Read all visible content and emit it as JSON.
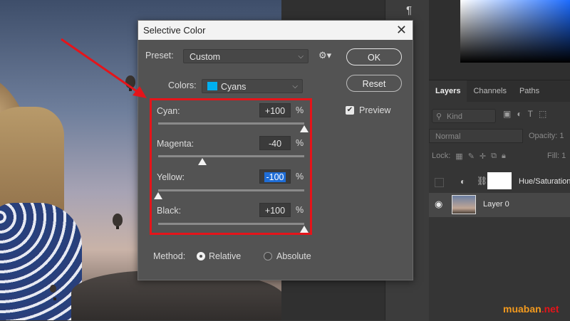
{
  "dialog": {
    "title": "Selective Color",
    "preset_label": "Preset:",
    "preset_value": "Custom",
    "colors_label": "Colors:",
    "colors_value": "Cyans",
    "colors_swatch": "#00b0f0",
    "ok_label": "OK",
    "reset_label": "Reset",
    "preview_label": "Preview",
    "preview_checked": true,
    "sliders": [
      {
        "label": "Cyan:",
        "value": "+100",
        "unit": "%",
        "level": 100
      },
      {
        "label": "Magenta:",
        "value": "-40",
        "unit": "%",
        "level": -40
      },
      {
        "label": "Yellow:",
        "value": "-100",
        "unit": "%",
        "level": -100
      },
      {
        "label": "Black:",
        "value": "+100",
        "unit": "%",
        "level": 100
      }
    ],
    "method_label": "Method:",
    "method_relative": "Relative",
    "method_absolute": "Absolute",
    "method_selected": "Relative"
  },
  "layers_panel": {
    "tabs": [
      "Layers",
      "Channels",
      "Paths"
    ],
    "kind_placeholder": "Kind",
    "blend_mode": "Normal",
    "opacity_label": "Opacity:",
    "opacity_value": "1",
    "lock_label": "Lock:",
    "fill_label": "Fill:",
    "fill_value": "1",
    "layers": [
      "Hue/Saturation",
      "Layer 0"
    ]
  },
  "colors": {
    "highlight": "#e5141a",
    "accent": "#00b0f0"
  },
  "watermark": {
    "brand": "muaban",
    "suffix": ".net",
    "brand_color": "#f39a1e",
    "suffix_color": "#e5141a"
  }
}
